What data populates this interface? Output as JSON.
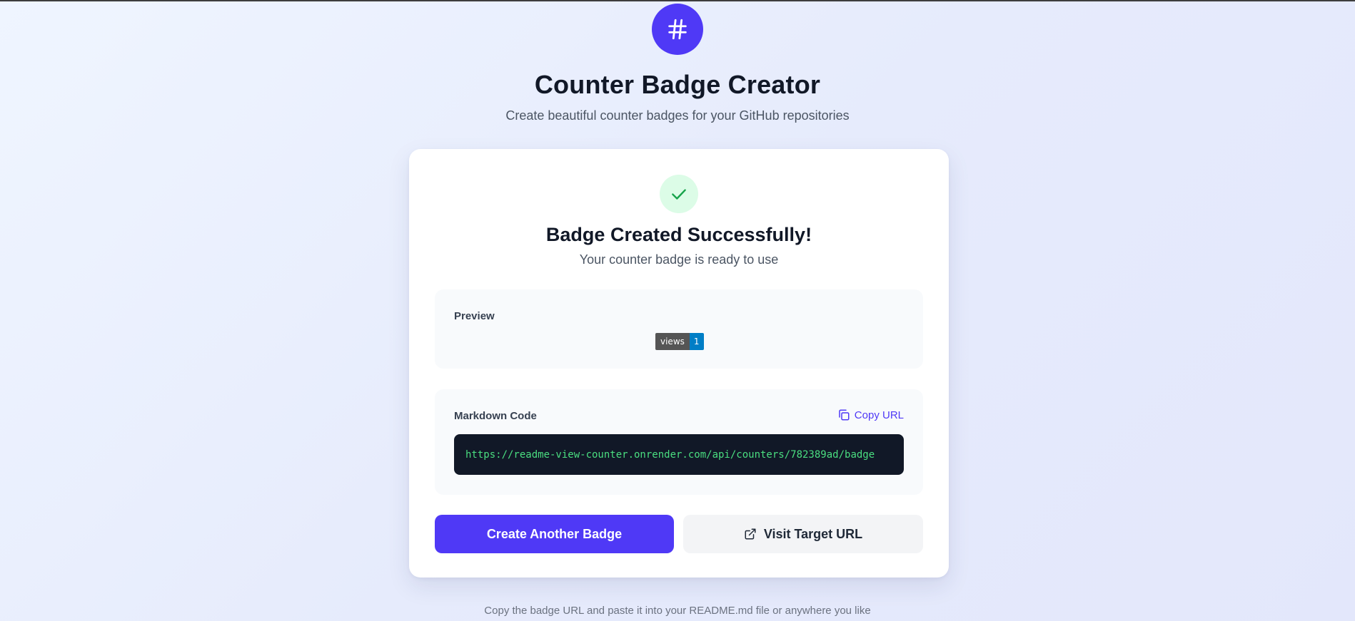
{
  "header": {
    "logo_icon": "hash-icon",
    "title": "Counter Badge Creator",
    "subtitle": "Create beautiful counter badges for your GitHub repositories"
  },
  "card": {
    "success_icon": "check-icon",
    "title": "Badge Created Successfully!",
    "subtitle": "Your counter badge is ready to use",
    "preview": {
      "label": "Preview",
      "badge_label": "views",
      "badge_count": "1"
    },
    "markdown": {
      "label": "Markdown Code",
      "copy_label": "Copy URL",
      "copy_icon": "copy-icon",
      "code": "https://readme-view-counter.onrender.com/api/counters/782389ad/badge"
    },
    "buttons": {
      "primary_label": "Create Another Badge",
      "secondary_label": "Visit Target URL",
      "secondary_icon": "external-link-icon"
    }
  },
  "footer": {
    "note": "Copy the badge URL and paste it into your README.md file or anywhere you like"
  },
  "colors": {
    "accent": "#4f39f6",
    "success_bg": "#dcfce7",
    "success_fg": "#16a34a",
    "code_bg": "#111827",
    "code_fg": "#4ade80",
    "badge_label_bg": "#555555",
    "badge_count_bg": "#007ec6"
  }
}
